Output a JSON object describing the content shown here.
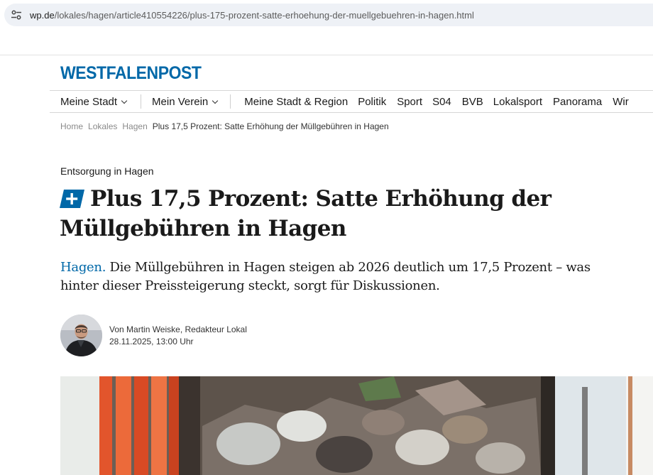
{
  "browser": {
    "url_host": "wp.de",
    "url_path": "/lokales/hagen/article410554226/plus-175-prozent-satte-erhoehung-der-muellgebuehren-in-hagen.html"
  },
  "site": {
    "logo_text": "WESTFALENPOST",
    "brand_color": "#0068a8"
  },
  "nav": {
    "dropdowns": [
      "Meine Stadt",
      "Mein Verein"
    ],
    "links": [
      "Meine Stadt & Region",
      "Politik",
      "Sport",
      "S04",
      "BVB",
      "Lokalsport",
      "Panorama",
      "Wir"
    ]
  },
  "breadcrumb": {
    "items": [
      "Home",
      "Lokales",
      "Hagen"
    ],
    "current": "Plus 17,5 Prozent: Satte Erhöhung der Müllgebühren in Hagen"
  },
  "article": {
    "kicker": "Entsorgung in Hagen",
    "headline": "Plus 17,5 Prozent: Satte Erhöhung der Müllgebühren in Hagen",
    "teaser_place": "Hagen.",
    "teaser_text": "Die Müllgebühren in Hagen steigen ab 2026 deutlich um 17,5 Prozent – was hinter dieser Preissteigerung steckt, sorgt für Diskussionen.",
    "author": "Von Martin Weiske, Redakteur Lokal",
    "date": "28.11.2025, 13:00 Uhr",
    "icons": {
      "premium": "plus-icon",
      "site_info": "tune-icon"
    }
  }
}
